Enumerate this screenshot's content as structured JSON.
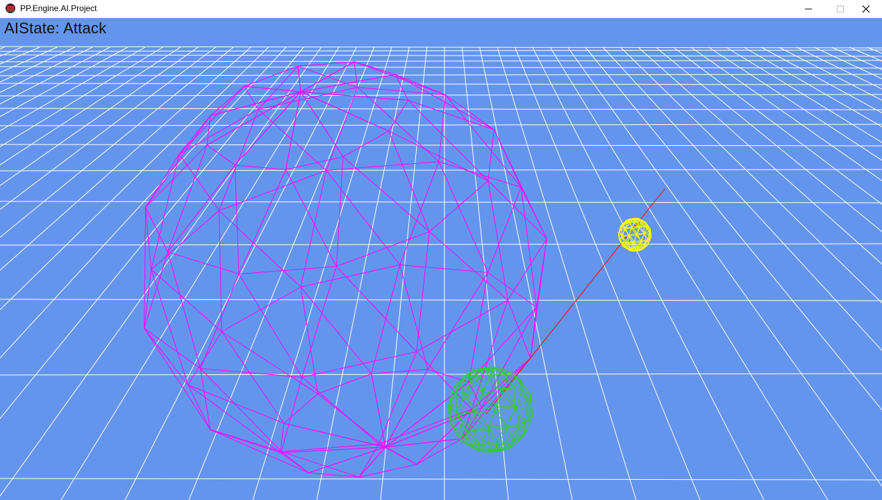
{
  "window": {
    "title": "PP.Engine.AI.Project",
    "controls": {
      "minimize": "minimize",
      "maximize": "maximize",
      "close": "close"
    }
  },
  "hud": {
    "ai_state_text": "AIState: Attack"
  },
  "scene": {
    "background_color": "#6495ED",
    "grid_color": "#FFFFFF",
    "objects": [
      {
        "name": "large-wireframe-sphere",
        "color": "#FF00FF"
      },
      {
        "name": "player-wireframe-sphere",
        "color": "#33CC33"
      },
      {
        "name": "target-wireframe-sphere",
        "color": "#FFFF00"
      },
      {
        "name": "aim-ray",
        "color": "#FF0000"
      }
    ]
  }
}
